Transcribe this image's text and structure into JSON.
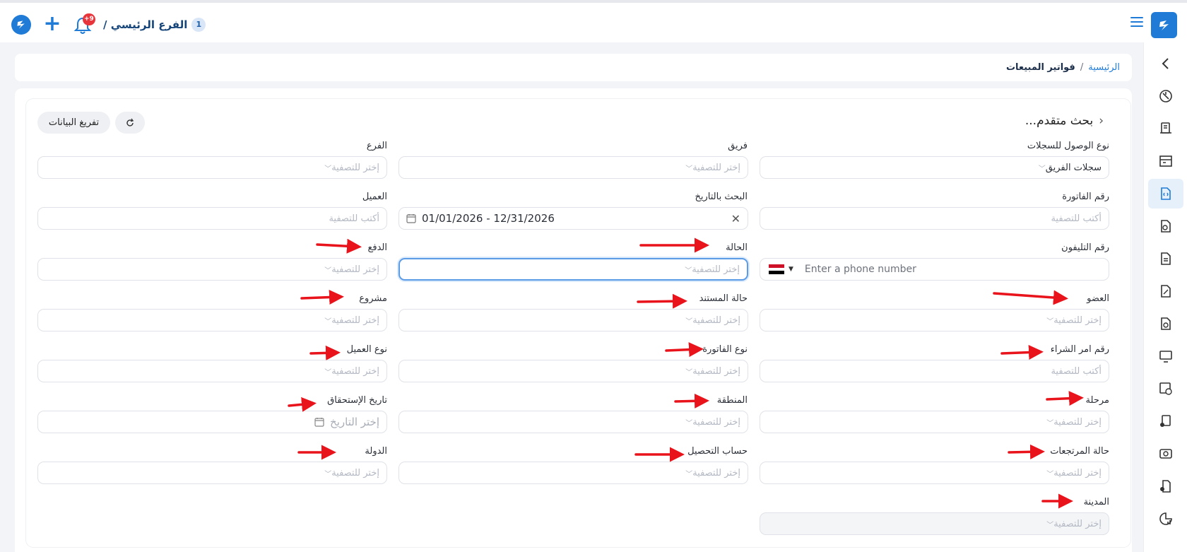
{
  "topbar": {
    "branch_number": "1",
    "branch_name": "الفرع الرئيسي /",
    "notifications_badge": "+9"
  },
  "breadcrumb": {
    "home": "الرئيسية",
    "separator": "/",
    "current": "فواتير المبيعات"
  },
  "panel": {
    "title": "بحث متقدم...",
    "clear_button": "تفريغ البيانات"
  },
  "filters": {
    "record_access_type": {
      "label": "نوع الوصول للسجلات",
      "value": "سجلات الفريق"
    },
    "team": {
      "label": "فريق",
      "placeholder": "إختر للتصفية"
    },
    "branch": {
      "label": "الفرع",
      "placeholder": "إختر للتصفية"
    },
    "invoice_number": {
      "label": "رقم الفاتورة",
      "placeholder": "أكتب للتصفية"
    },
    "date_search": {
      "label": "البحث بالتاريخ",
      "value": "01/01/2026 - 12/31/2026"
    },
    "customer": {
      "label": "العميل",
      "placeholder": "أكتب للتصفية"
    },
    "phone": {
      "label": "رقم التليفون",
      "placeholder": "Enter a phone number"
    },
    "status": {
      "label": "الحالة",
      "placeholder": "إختر للتصفية"
    },
    "payment": {
      "label": "الدفع",
      "placeholder": "إختر للتصفية"
    },
    "member": {
      "label": "العضو",
      "placeholder": "إختر للتصفية"
    },
    "document_status": {
      "label": "حالة المستند",
      "placeholder": "إختر للتصفية"
    },
    "project": {
      "label": "مشروع",
      "placeholder": "إختر للتصفية"
    },
    "po_number": {
      "label": "رقم امر الشراء",
      "placeholder": "أكتب للتصفية"
    },
    "invoice_type": {
      "label": "نوع الفاتورة",
      "placeholder": "إختر للتصفية"
    },
    "customer_type": {
      "label": "نوع العميل",
      "placeholder": "إختر للتصفية"
    },
    "stage": {
      "label": "مرحلة",
      "placeholder": "إختر للتصفية"
    },
    "region": {
      "label": "المنطقة",
      "placeholder": "إختر للتصفية"
    },
    "due_date": {
      "label": "تاريخ الإستحقاق",
      "placeholder": "إختر التاريخ"
    },
    "returns_status": {
      "label": "حالة المرتجعات",
      "placeholder": "إختر للتصفية"
    },
    "collection_account": {
      "label": "حساب التحصيل",
      "placeholder": "إختر للتصفية"
    },
    "country": {
      "label": "الدولة",
      "placeholder": "إختر للتصفية"
    },
    "city": {
      "label": "المدينة",
      "placeholder": "إختر للتصفية"
    }
  },
  "colors": {
    "brand": "#1f7bd6",
    "annotation_arrow": "#e8131b",
    "badge": "#e8353b"
  }
}
